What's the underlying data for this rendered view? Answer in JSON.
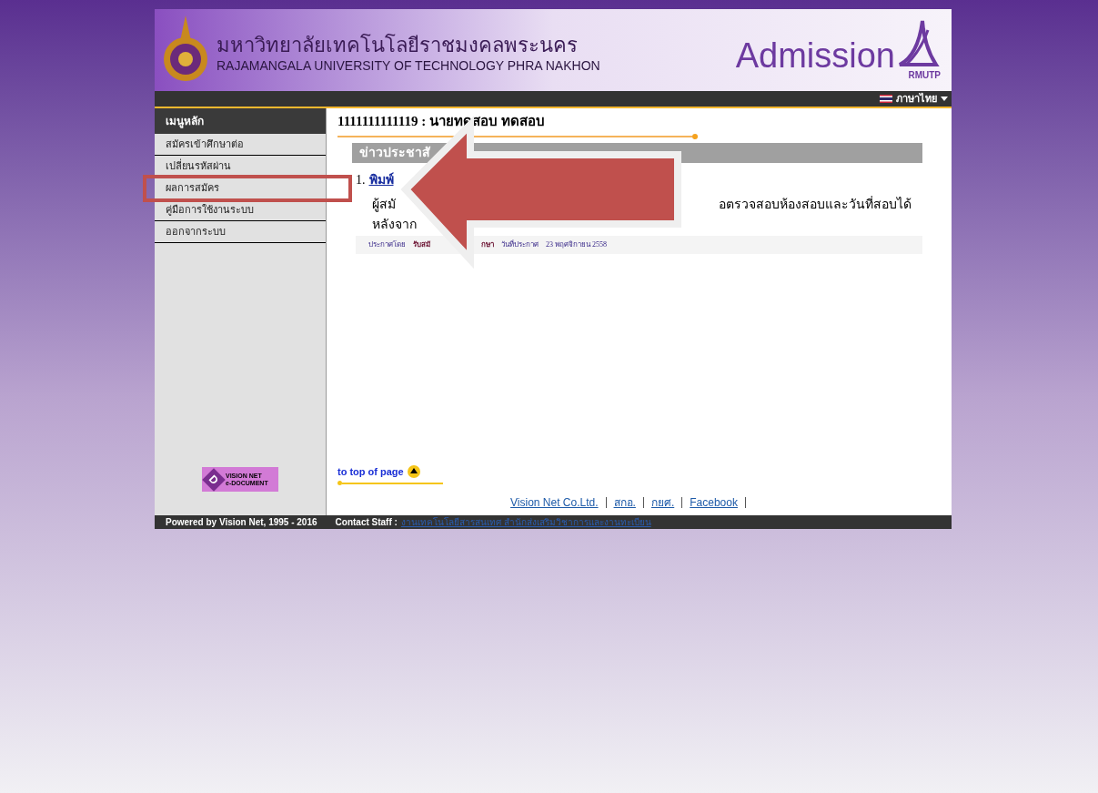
{
  "header": {
    "thai_name": "มหาวิทยาลัยเทคโนโลยีราชมงคลพระนคร",
    "english_name": "RAJAMANGALA UNIVERSITY OF TECHNOLOGY PHRA NAKHON",
    "logo_text": "Admission",
    "logo_subtext": "RMUTP"
  },
  "language": {
    "label": "ภาษาไทย"
  },
  "sidebar": {
    "title": "เมนูหลัก",
    "items": [
      {
        "label": "สมัครเข้าศึกษาต่อ"
      },
      {
        "label": "เปลี่ยนรหัสผ่าน"
      },
      {
        "label": "ผลการสมัคร"
      },
      {
        "label": "คู่มือการใช้งานระบบ"
      },
      {
        "label": "ออกจากระบบ"
      }
    ],
    "badge": {
      "top": "VISION NET",
      "bottom": "e-DOCUMENT",
      "letter": "D"
    }
  },
  "user": {
    "line": "1111111111119 :  นายทดสอบ ทดสอบ"
  },
  "news": {
    "title": "ข่าวประชาสั",
    "items": [
      {
        "number": "1.",
        "link": "พิมพ์",
        "body_left": "ผู้สมั",
        "body_right": "อตรวจสอบห้องสอบและวันที่สอบได้",
        "body_line2": "หลังจาก",
        "meta_left": "ประกาศโดย",
        "meta_by": "รับสมั",
        "meta_by_rest": "กษา",
        "meta_date_label": "วันที่ประกาศ",
        "meta_date": "23 พฤศจิกายน 2558"
      }
    ]
  },
  "to_top": {
    "label": "to top of page"
  },
  "footer_links": [
    "Vision Net Co.Ltd.",
    "สกอ.",
    "กยศ.",
    "Facebook"
  ],
  "bottom_bar": {
    "powered": "Powered by Vision Net, 1995 - 2016",
    "contact_label": "Contact Staff :",
    "contact_link": "งานเทคโนโลยีสารสนเทศ สำนักส่งเสริมวิชาการและงานทะเบียน"
  }
}
